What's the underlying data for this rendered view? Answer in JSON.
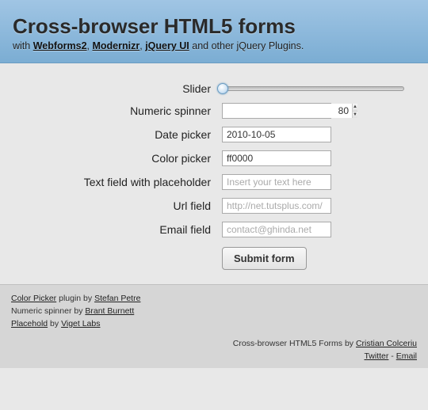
{
  "header": {
    "title": "Cross-browser HTML5 forms",
    "sub_prefix": "with ",
    "links": [
      "Webforms2",
      "Modernizr",
      "jQuery UI"
    ],
    "sub_suffix": " and other jQuery Plugins."
  },
  "form": {
    "slider": {
      "label": "Slider"
    },
    "spinner": {
      "label": "Numeric spinner",
      "value": "80"
    },
    "date": {
      "label": "Date picker",
      "value": "2010-10-05"
    },
    "color": {
      "label": "Color picker",
      "value": "ff0000"
    },
    "text": {
      "label": "Text field with placeholder",
      "placeholder": "Insert your text here"
    },
    "url": {
      "label": "Url field",
      "placeholder": "http://net.tutsplus.com/"
    },
    "email": {
      "label": "Email field",
      "placeholder": "contact@ghinda.net"
    },
    "submit": "Submit form"
  },
  "footer": {
    "line1_a": "Color Picker",
    "line1_mid": " plugin by ",
    "line1_b": "Stefan Petre",
    "line2_pre": "Numeric spinner by ",
    "line2_a": "Brant Burnett",
    "line3_a": "Placehold",
    "line3_mid": " by ",
    "line3_b": "Viget Labs",
    "right_pre": "Cross-browser HTML5 Forms by ",
    "right_a": "Cristian Colceriu",
    "right_b": "Twitter",
    "right_sep": " - ",
    "right_c": "Email"
  }
}
